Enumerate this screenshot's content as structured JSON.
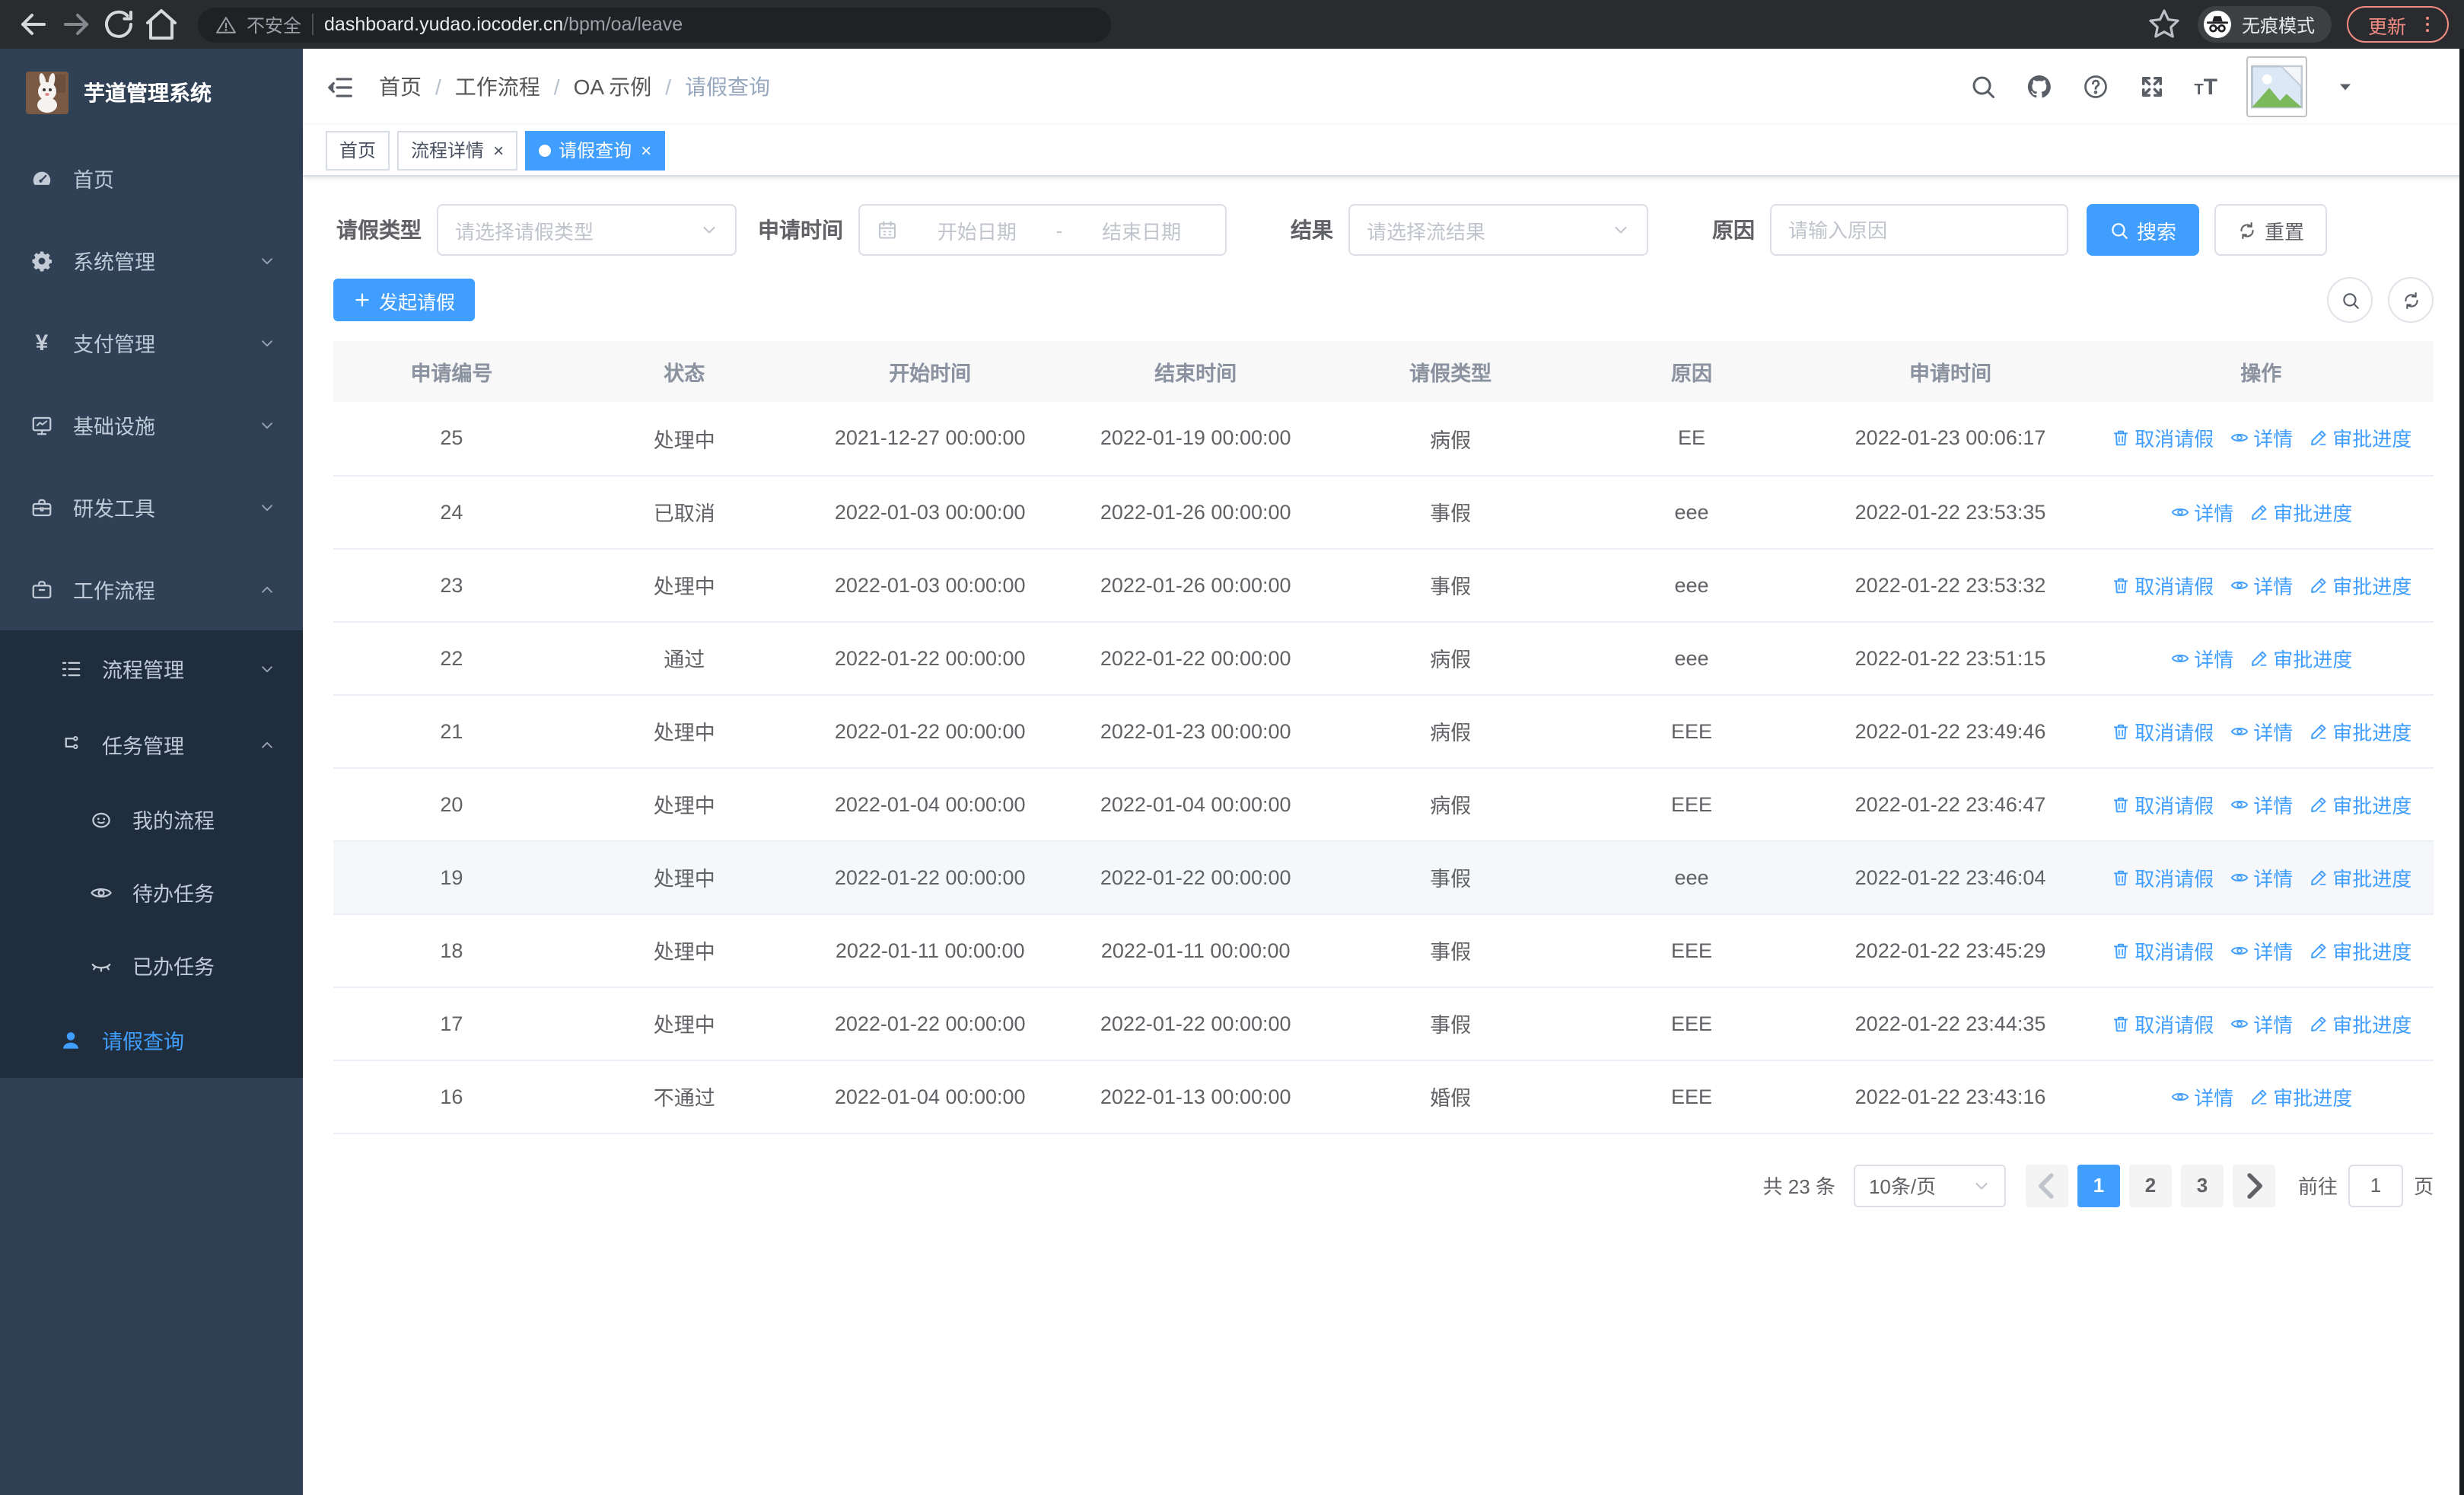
{
  "colors": {
    "primary": "#409eff",
    "sidebar_bg": "#304156",
    "submenu_bg": "#1f2d3d",
    "update_accent": "#f28b82",
    "link_blue": "#409eff"
  },
  "browser": {
    "security_label": "不安全",
    "url_domain": "dashboard.yudao.iocoder.cn",
    "url_path": "/bpm/oa/leave",
    "incognito_label": "无痕模式",
    "update_label": "更新"
  },
  "sidebar": {
    "title": "芋道管理系统",
    "items": [
      {
        "key": "home",
        "label": "首页",
        "icon": "dashboard",
        "level": 1
      },
      {
        "key": "system-mgmt",
        "label": "系统管理",
        "icon": "gear",
        "level": 1,
        "chevron": "down"
      },
      {
        "key": "pay-mgmt",
        "label": "支付管理",
        "icon": "yen",
        "level": 1,
        "chevron": "down"
      },
      {
        "key": "infrastructure",
        "label": "基础设施",
        "icon": "monitor",
        "level": 1,
        "chevron": "down"
      },
      {
        "key": "dev-tools",
        "label": "研发工具",
        "icon": "toolbox",
        "level": 1,
        "chevron": "down"
      },
      {
        "key": "workflow",
        "label": "工作流程",
        "icon": "briefcase",
        "level": 1,
        "chevron": "up"
      },
      {
        "key": "process-mgmt",
        "label": "流程管理",
        "icon": "list",
        "level": 2,
        "sub": true,
        "chevron": "down"
      },
      {
        "key": "task-mgmt",
        "label": "任务管理",
        "icon": "tree",
        "level": 2,
        "sub": true,
        "chevron": "up"
      },
      {
        "key": "my-process",
        "label": "我的流程",
        "icon": "face",
        "level": 3,
        "sub": true
      },
      {
        "key": "todo-tasks",
        "label": "待办任务",
        "icon": "eye-open",
        "level": 3,
        "sub": true
      },
      {
        "key": "done-tasks",
        "label": "已办任务",
        "icon": "eye-closed",
        "level": 3,
        "sub": true
      },
      {
        "key": "leave-query",
        "label": "请假查询",
        "icon": "user",
        "level": 2,
        "sub": true,
        "active": true
      }
    ]
  },
  "breadcrumb": {
    "separator": "/",
    "items": [
      {
        "label": "首页"
      },
      {
        "label": "工作流程"
      },
      {
        "label": "OA 示例"
      },
      {
        "label": "请假查询",
        "muted": true
      }
    ]
  },
  "tags": {
    "close_glyph": "×",
    "tabs": [
      {
        "label": "首页",
        "closable": false
      },
      {
        "label": "流程详情",
        "closable": true
      },
      {
        "label": "请假查询",
        "closable": true,
        "active": true
      }
    ]
  },
  "filters": {
    "leave_type_label": "请假类型",
    "leave_type_placeholder": "请选择请假类型",
    "apply_time_label": "申请时间",
    "date_start_placeholder": "开始日期",
    "date_separator": "-",
    "date_end_placeholder": "结束日期",
    "result_label": "结果",
    "result_placeholder": "请选择流结果",
    "reason_label": "原因",
    "reason_placeholder": "请输入原因",
    "search_label": "搜索",
    "reset_label": "重置"
  },
  "toolbar": {
    "create_label": "发起请假"
  },
  "table": {
    "columns": [
      "申请编号",
      "状态",
      "开始时间",
      "结束时间",
      "请假类型",
      "原因",
      "申请时间",
      "操作"
    ],
    "action_labels": {
      "cancel": "取消请假",
      "detail": "详情",
      "progress": "审批进度"
    },
    "rows": [
      {
        "id": "25",
        "status": "处理中",
        "start": "2021-12-27 00:00:00",
        "end": "2022-01-19 00:00:00",
        "type": "病假",
        "reason": "EE",
        "applied": "2022-01-23 00:06:17",
        "actions": [
          "cancel",
          "detail",
          "progress"
        ]
      },
      {
        "id": "24",
        "status": "已取消",
        "start": "2022-01-03 00:00:00",
        "end": "2022-01-26 00:00:00",
        "type": "事假",
        "reason": "eee",
        "applied": "2022-01-22 23:53:35",
        "actions": [
          "detail",
          "progress"
        ]
      },
      {
        "id": "23",
        "status": "处理中",
        "start": "2022-01-03 00:00:00",
        "end": "2022-01-26 00:00:00",
        "type": "事假",
        "reason": "eee",
        "applied": "2022-01-22 23:53:32",
        "actions": [
          "cancel",
          "detail",
          "progress"
        ]
      },
      {
        "id": "22",
        "status": "通过",
        "start": "2022-01-22 00:00:00",
        "end": "2022-01-22 00:00:00",
        "type": "病假",
        "reason": "eee",
        "applied": "2022-01-22 23:51:15",
        "actions": [
          "detail",
          "progress"
        ]
      },
      {
        "id": "21",
        "status": "处理中",
        "start": "2022-01-22 00:00:00",
        "end": "2022-01-23 00:00:00",
        "type": "病假",
        "reason": "EEE",
        "applied": "2022-01-22 23:49:46",
        "actions": [
          "cancel",
          "detail",
          "progress"
        ]
      },
      {
        "id": "20",
        "status": "处理中",
        "start": "2022-01-04 00:00:00",
        "end": "2022-01-04 00:00:00",
        "type": "病假",
        "reason": "EEE",
        "applied": "2022-01-22 23:46:47",
        "actions": [
          "cancel",
          "detail",
          "progress"
        ]
      },
      {
        "id": "19",
        "status": "处理中",
        "start": "2022-01-22 00:00:00",
        "end": "2022-01-22 00:00:00",
        "type": "事假",
        "reason": "eee",
        "applied": "2022-01-22 23:46:04",
        "actions": [
          "cancel",
          "detail",
          "progress"
        ],
        "highlighted": true
      },
      {
        "id": "18",
        "status": "处理中",
        "start": "2022-01-11 00:00:00",
        "end": "2022-01-11 00:00:00",
        "type": "事假",
        "reason": "EEE",
        "applied": "2022-01-22 23:45:29",
        "actions": [
          "cancel",
          "detail",
          "progress"
        ]
      },
      {
        "id": "17",
        "status": "处理中",
        "start": "2022-01-22 00:00:00",
        "end": "2022-01-22 00:00:00",
        "type": "事假",
        "reason": "EEE",
        "applied": "2022-01-22 23:44:35",
        "actions": [
          "cancel",
          "detail",
          "progress"
        ]
      },
      {
        "id": "16",
        "status": "不通过",
        "start": "2022-01-04 00:00:00",
        "end": "2022-01-13 00:00:00",
        "type": "婚假",
        "reason": "EEE",
        "applied": "2022-01-22 23:43:16",
        "actions": [
          "detail",
          "progress"
        ]
      }
    ]
  },
  "pagination": {
    "total_label": "共 23 条",
    "page_size": "10条/页",
    "pages": [
      "1",
      "2",
      "3"
    ],
    "active_page": "1",
    "goto_label": "前往",
    "goto_value": "1",
    "page_suffix_label": "页"
  }
}
